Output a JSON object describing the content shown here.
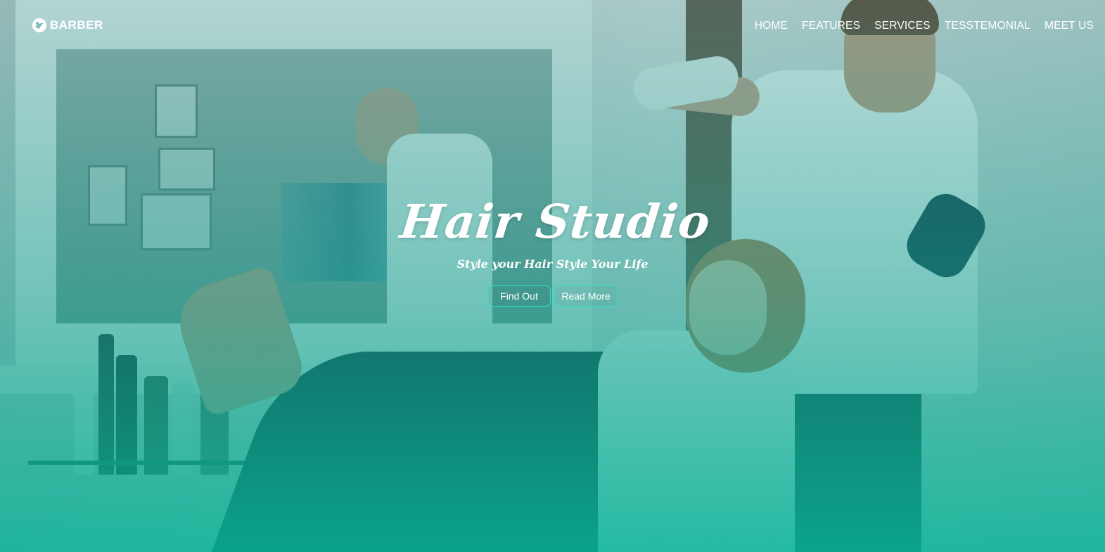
{
  "brand": {
    "name": "BARBER",
    "icon": "barber-logo-icon"
  },
  "nav": {
    "items": [
      {
        "label": "HOME"
      },
      {
        "label": "FEATURES"
      },
      {
        "label": "SERVICES"
      },
      {
        "label": "TESSTEMONIAL"
      },
      {
        "label": "MEET US"
      }
    ]
  },
  "hero": {
    "title": "Hair Studio",
    "subtitle": "Style your Hair Style Your Life",
    "buttons": {
      "find_out": "Find Out",
      "read_more": "Read More"
    }
  },
  "colors": {
    "overlay_top": "#1a8c8c",
    "overlay_bottom": "#08b296",
    "button_border": "#2de3d0",
    "text": "#ffffff"
  }
}
